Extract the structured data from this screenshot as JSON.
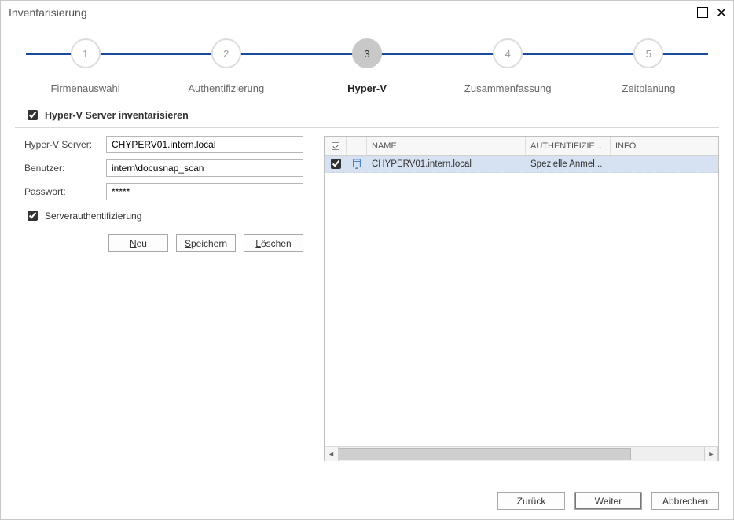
{
  "window": {
    "title": "Inventarisierung"
  },
  "wizard": {
    "steps": [
      {
        "num": "1",
        "label": "Firmenauswahl"
      },
      {
        "num": "2",
        "label": "Authentifizierung"
      },
      {
        "num": "3",
        "label": "Hyper-V"
      },
      {
        "num": "4",
        "label": "Zusammenfassung"
      },
      {
        "num": "5",
        "label": "Zeitplanung"
      }
    ],
    "activeIndex": 2
  },
  "section": {
    "inventory_label": "Hyper-V Server inventarisieren",
    "inventory_checked": true
  },
  "form": {
    "server_label": "Hyper-V Server:",
    "server_value": "CHYPERV01.intern.local",
    "user_label": "Benutzer:",
    "user_value": "intern\\docusnap_scan",
    "password_label": "Passwort:",
    "password_value": "*****",
    "serverauth_label": "Serverauthentifizierung",
    "serverauth_checked": true,
    "btn_new": "Neu",
    "btn_new_ul": "N",
    "btn_new_rest": "eu",
    "btn_save": "Speichern",
    "btn_save_ul": "S",
    "btn_save_rest": "peichern",
    "btn_delete": "Löschen",
    "btn_delete_ul": "L",
    "btn_delete_rest": "öschen"
  },
  "grid": {
    "headers": {
      "name": "NAME",
      "auth": "AUTHENTIFIZIE...",
      "info": "INFO"
    },
    "rows": [
      {
        "checked": true,
        "name": "CHYPERV01.intern.local",
        "auth": "Spezielle Anmel...",
        "info": ""
      }
    ]
  },
  "footer": {
    "back": "Zurück",
    "next": "Weiter",
    "cancel": "Abbrechen"
  }
}
